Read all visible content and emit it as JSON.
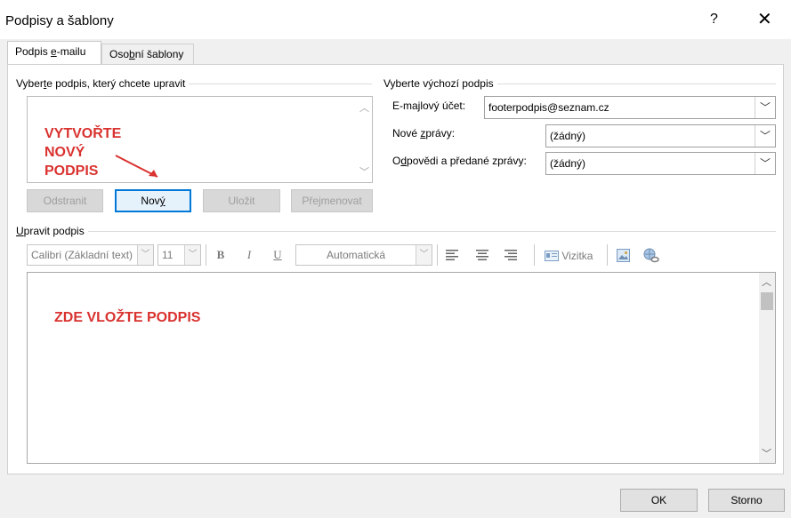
{
  "window": {
    "title": "Podpisy a šablony",
    "help_label": "?",
    "close_label": "✕"
  },
  "tabs": [
    {
      "label_pre": "Podpis ",
      "label_acc": "e",
      "label_post": "-mailu",
      "active": true
    },
    {
      "label_pre": "Oso",
      "label_acc": "b",
      "label_post": "ní šablony",
      "active": false
    }
  ],
  "select_signature": {
    "label_pre": "Vyber",
    "label_acc": "t",
    "label_post": "e podpis, který chcete upravit",
    "annotation": [
      "VYTVOŘTE",
      "NOVÝ",
      "PODPIS"
    ]
  },
  "buttons": {
    "delete": "Odstranit",
    "new_pre": "Nov",
    "new_acc": "ý",
    "new_post": "",
    "save": "Uložit",
    "rename": "Přejmenovat"
  },
  "default_signature": {
    "label": "Vyberte výchozí podpis",
    "account_label_pre": "E-ma",
    "account_label_acc": "j",
    "account_label_post": "lový účet:",
    "account_value": "footerpodpis@seznam.cz",
    "new_messages_label_pre": "Nové ",
    "new_messages_label_acc": "z",
    "new_messages_label_post": "právy:",
    "new_messages_value": "(žádný)",
    "replies_label_pre": "O",
    "replies_label_acc": "d",
    "replies_label_post": "povědi a předané zprávy:",
    "replies_value": "(žádný)"
  },
  "edit_signature": {
    "label_pre": "",
    "label_acc": "U",
    "label_post": "pravit podpis",
    "font": "Calibri (Základní text)",
    "size": "11",
    "bold": "B",
    "italic": "I",
    "underline": "U",
    "color": "Automatická",
    "business_card": "Vizitka",
    "placeholder_annotation": "ZDE VLOŽTE PODPIS"
  },
  "footer": {
    "ok": "OK",
    "cancel": "Storno"
  },
  "colors": {
    "accent": "#0078d7",
    "annotation_red": "#d9322f"
  }
}
